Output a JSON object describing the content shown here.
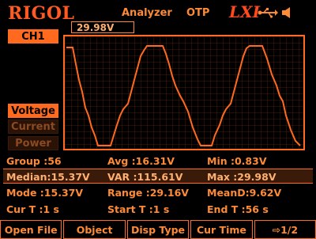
{
  "header": {
    "brand": "RIGOL",
    "mode": "Analyzer",
    "protection": "OTP",
    "lxi": "LXI",
    "icons": [
      "usb-icon",
      "speaker-icon"
    ]
  },
  "channel": {
    "label": "CH1"
  },
  "cursor_value": "29.98V",
  "side_menu": [
    {
      "label": "Voltage",
      "active": true
    },
    {
      "label": "Current",
      "active": false
    },
    {
      "label": "Power",
      "active": false
    }
  ],
  "stats": {
    "row1": {
      "c1": "Group :56",
      "c2": "Avg :16.31V",
      "c3": "Min :0.83V"
    },
    "row2": {
      "c1": "Median:15.37V",
      "c2": "VAR :115.61V",
      "c3": "Max :29.98V"
    },
    "row3": {
      "c1": "Mode :15.37V",
      "c2": "Range :29.16V",
      "c3": "MeanD:9.62V"
    },
    "row4": {
      "c1": "Cur T :1 s",
      "c2": "Start T :1 s",
      "c3": "End T :56 s"
    }
  },
  "softkeys": [
    "Open File",
    "Object",
    "Disp Type",
    "Cur Time",
    "⇨1/2"
  ],
  "colors": {
    "accent": "#ff6a1e",
    "text": "#ff8a35",
    "background": "#000000"
  }
}
